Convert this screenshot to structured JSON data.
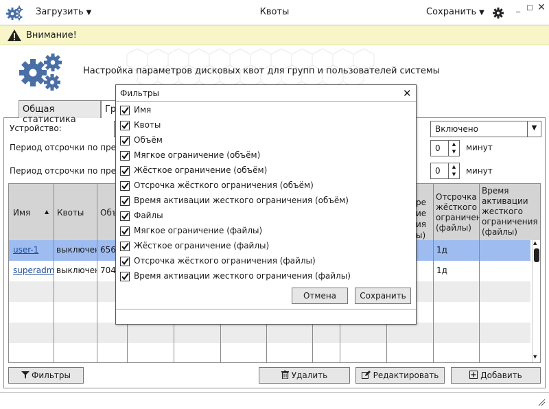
{
  "app": {
    "title": "Квоты",
    "upload_menu": "Загрузить",
    "save_menu": "Сохранить"
  },
  "warning": {
    "text": "Внимание!"
  },
  "header": {
    "title": "Настройка параметров дисковых квот для групп и пользователей системы"
  },
  "tabs": [
    {
      "label": "Общая статистика"
    },
    {
      "label": "Гр"
    }
  ],
  "form": {
    "device_label": "Устройство:",
    "device_value": "Включено",
    "grace_label_1": "Период отсрочки по превы",
    "grace_label_2": "Период отсрочки по превы",
    "grace_value_1": "0",
    "grace_value_2": "0",
    "minutes_label": "минут"
  },
  "table": {
    "headers": {
      "name": "Имя",
      "quotas": "Квоты",
      "volume": "Объ",
      "partial": "ре",
      "partial2": "ие",
      "partial3": "ия",
      "partial4": "ы)",
      "grace_files_l1": "Отсрочка",
      "grace_files_l2": "жёсткого",
      "grace_files_l3": "ограничения",
      "grace_files_l4": "(файлы)",
      "activation_l1": "Время",
      "activation_l2": "активации",
      "activation_l3": "жесткого",
      "activation_l4": "ограничения",
      "activation_l5": "(файлы)"
    },
    "rows": [
      {
        "name": "user-1",
        "quotas": "выключен",
        "volume": "656",
        "grace": "1д"
      },
      {
        "name": "superadm",
        "quotas": "выключен",
        "volume": "704",
        "grace": "1д"
      }
    ]
  },
  "buttons": {
    "filters": "Фильтры",
    "delete": "Удалить",
    "edit": "Редактировать",
    "add": "Добавить"
  },
  "modal": {
    "title": "Фильтры",
    "items": [
      {
        "label": "Имя",
        "checked": true
      },
      {
        "label": "Квоты",
        "checked": true
      },
      {
        "label": "Объём",
        "checked": true
      },
      {
        "label": "Мягкое ограничение (объём)",
        "checked": true
      },
      {
        "label": "Жёсткое ограничение (объём)",
        "checked": true
      },
      {
        "label": "Отсрочка жёсткого ограничения (объём)",
        "checked": true
      },
      {
        "label": "Время активации жесткого ограничения (объём)",
        "checked": true
      },
      {
        "label": "Файлы",
        "checked": true
      },
      {
        "label": "Мягкое ограничение (файлы)",
        "checked": true
      },
      {
        "label": "Жёсткое ограничение (файлы)",
        "checked": true
      },
      {
        "label": "Отсрочка жёсткого ограничения (файлы)",
        "checked": true
      },
      {
        "label": "Время активации жесткого ограничения (файлы)",
        "checked": true
      }
    ],
    "cancel": "Отмена",
    "save": "Сохранить"
  },
  "colors": {
    "selected_row": "#9ebcf0",
    "warning_bg": "#f8f6c8",
    "header_bg": "#d4d4d4",
    "gear_blue": "#4a6fa5"
  },
  "icons": [
    "gears-icon",
    "caret-down-icon",
    "settings-gear-icon",
    "minimize-icon",
    "maximize-icon",
    "close-icon",
    "warning-icon",
    "filter-icon",
    "trash-icon",
    "edit-icon",
    "plus-icon",
    "check-icon",
    "resize-grip-icon"
  ]
}
